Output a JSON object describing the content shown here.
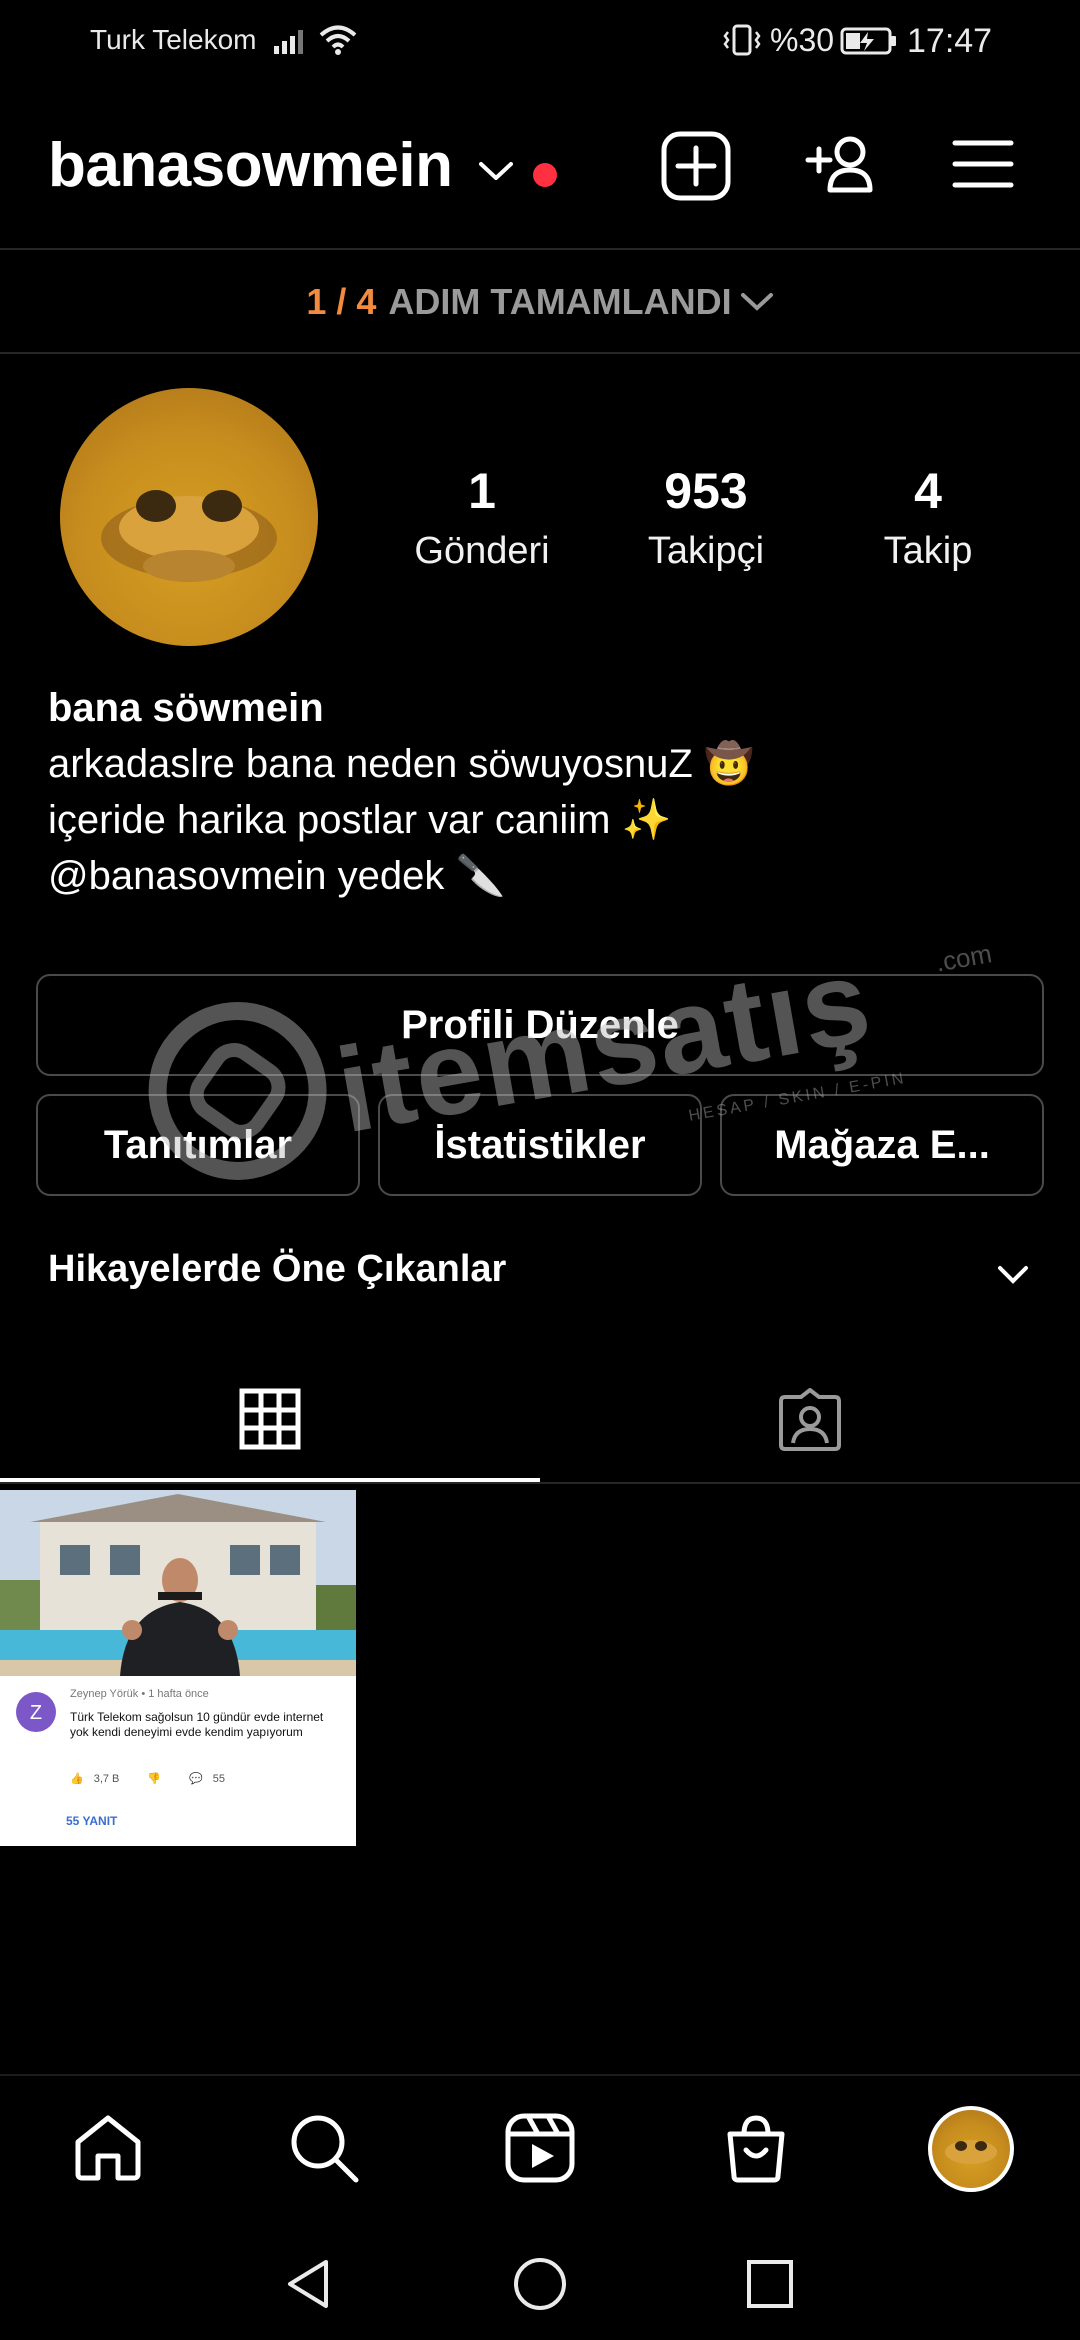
{
  "status_bar": {
    "carrier": "Turk Telekom",
    "battery_percent": "%30",
    "time": "17:47",
    "icons": [
      "signal-icon",
      "wifi-icon",
      "vibrate-icon",
      "battery-charging-icon"
    ]
  },
  "header": {
    "username": "banasowmein",
    "icons": [
      "chevron-down-icon",
      "add-post-icon",
      "add-user-icon",
      "menu-icon"
    ],
    "notification_dot_color": "#ff3040"
  },
  "progress": {
    "count": "1 / 4",
    "text": "ADIM TAMAMLANDI",
    "count_color": "#f28a40"
  },
  "profile": {
    "stats": [
      {
        "value": "1",
        "label": "Gönderi"
      },
      {
        "value": "953",
        "label": "Takipçi"
      },
      {
        "value": "4",
        "label": "Takip"
      }
    ],
    "bio": {
      "name": "bana söwmein",
      "line1": "arkadaslre bana neden söwuyosnuZ 🤠",
      "line2": "içeride harika postlar var caniim ✨",
      "line3": "@banasovmein yedek 🔪"
    }
  },
  "buttons": {
    "edit_profile": "Profili Düzenle",
    "promotions": "Tanıtımlar",
    "insights": "İstatistikler",
    "shop": "Mağaza E..."
  },
  "highlights": {
    "label": "Hikayelerde Öne Çıkanlar"
  },
  "tabs": [
    "grid-icon",
    "tagged-icon"
  ],
  "post": {
    "comment_author": "Zeynep Yörük • 1 hafta önce",
    "comment_avatar_letter": "Z",
    "comment_text": "Türk Telekom sağolsun 10 gündür evde internet yok kendi deneyimi evde kendim yapıyorum",
    "likes": "3,7 B",
    "comments": "55",
    "replies": "55 YANIT"
  },
  "bottom_nav": [
    "home-icon",
    "search-icon",
    "reels-icon",
    "shop-icon",
    "profile-avatar"
  ],
  "system_nav": [
    "back-icon",
    "home-circle-icon",
    "recents-icon"
  ],
  "watermark": {
    "text": "itemsatış",
    "sub": "HESAP / SKIN / E-PIN",
    "domain": ".com"
  }
}
